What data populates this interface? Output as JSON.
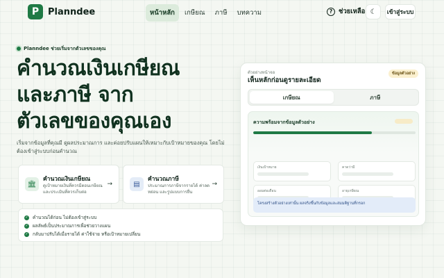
{
  "nav": {
    "logo_letter": "P",
    "brand": "Planndee",
    "links": [
      "หน้าหลัก",
      "เกษียณ",
      "ภาษี",
      "บทความ"
    ],
    "active_index": 0,
    "help": "ช่วยเหลือ",
    "login": "เข้าสู่ระบบ"
  },
  "hero": {
    "pill": "Planndee ช่วยเริ่มจากตัวเลขของคุณ",
    "headline": [
      "คำนวณเงินเกษียณ",
      "และภาษี จาก",
      "ตัวเลขของคุณเอง"
    ],
    "subtext": "เริ่มจากข้อมูลที่คุณมี ดูผลประมาณการ และค่อยปรับแผนให้เหมาะกับเป้าหมายของคุณ โดยไม่ต้องเข้าสู่ระบบก่อนคำนวณ"
  },
  "features": [
    {
      "title": "คำนวณเงินเกษียณ",
      "desc": "ดูเป้าหมายเงินที่ควรมีตอนเกษียณ และประเมินที่ควรเก็บต่อ",
      "icon": "bank-icon"
    },
    {
      "title": "คำนวณภาษี",
      "desc": "ประมาณการภาษีจากรายได้ ค่าลดหย่อน และรูปแบบการยื่น",
      "icon": "document-icon"
    }
  ],
  "checklist": [
    "คำนวณได้ก่อน ไม่ต้องเข้าสู่ระบบ",
    "ผลลัพธ์เป็นประมาณการเพื่อช่วยวางแผน",
    "กลับมาปรับได้เมื่อรายได้ ค่าใช้จ่าย หรือเป้าหมายเปลี่ยน"
  ],
  "preview": {
    "subtitle": "ตัวอย่างหน้าจอ",
    "title": "เห็นหลักก่อนดูรายละเอียด",
    "badge": "ข้อมูลตัวอย่าง",
    "tabs": [
      "เกษียณ",
      "ภาษี"
    ],
    "active_tab": 0,
    "panel_title": "ความพร้อมจากข้อมูลตัวอย่าง",
    "progress": 0.73,
    "fields": [
      "เงินเป้าหมาย",
      "คาดว่ามี",
      "ออมต่อเดือน",
      "อายุเกษียณ"
    ],
    "note": "โครงสร้างตัวอย่างเท่านั้น ผลจริงขึ้นกับข้อมูลและสมมติฐานที่กรอก"
  },
  "colors": {
    "brand": "#1f7a45",
    "badge_bg": "#fbf0cf",
    "note_bg": "#e3ecf9"
  }
}
